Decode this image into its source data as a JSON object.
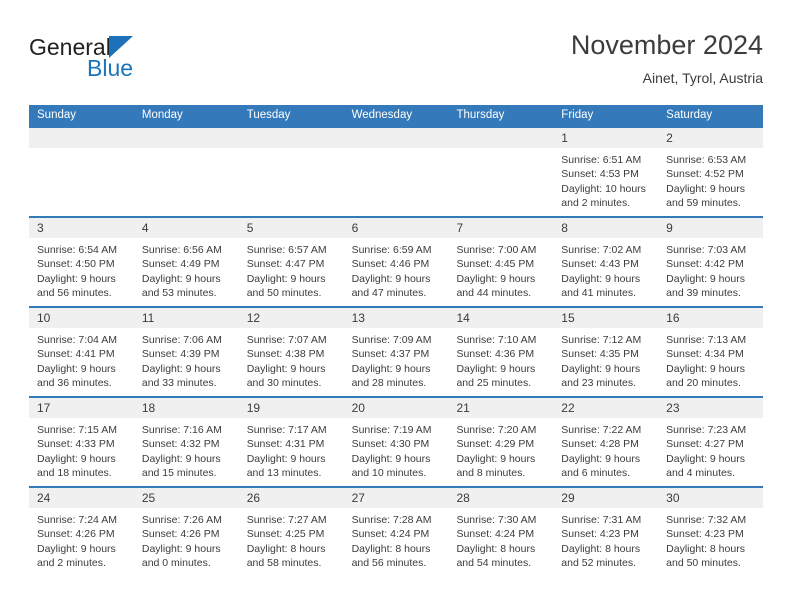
{
  "brand": {
    "name_part1": "General",
    "name_part2": "Blue",
    "triangle_color": "#1d71b8",
    "blue_color": "#1b75bb"
  },
  "header": {
    "title": "November 2024",
    "subtitle": "Ainet, Tyrol, Austria"
  },
  "theme": {
    "header_blue": "#3479ba",
    "daynum_band": "#f0f0f0",
    "text": "#3c3c3c"
  },
  "weekday_headers": [
    "Sunday",
    "Monday",
    "Tuesday",
    "Wednesday",
    "Thursday",
    "Friday",
    "Saturday"
  ],
  "weeks": [
    [
      {
        "day": "",
        "sunrise": "",
        "sunset": "",
        "daylight_line1": "",
        "daylight_line2": "",
        "empty": true
      },
      {
        "day": "",
        "sunrise": "",
        "sunset": "",
        "daylight_line1": "",
        "daylight_line2": "",
        "empty": true
      },
      {
        "day": "",
        "sunrise": "",
        "sunset": "",
        "daylight_line1": "",
        "daylight_line2": "",
        "empty": true
      },
      {
        "day": "",
        "sunrise": "",
        "sunset": "",
        "daylight_line1": "",
        "daylight_line2": "",
        "empty": true
      },
      {
        "day": "",
        "sunrise": "",
        "sunset": "",
        "daylight_line1": "",
        "daylight_line2": "",
        "empty": true
      },
      {
        "day": "1",
        "sunrise": "Sunrise: 6:51 AM",
        "sunset": "Sunset: 4:53 PM",
        "daylight_line1": "Daylight: 10 hours",
        "daylight_line2": "and 2 minutes."
      },
      {
        "day": "2",
        "sunrise": "Sunrise: 6:53 AM",
        "sunset": "Sunset: 4:52 PM",
        "daylight_line1": "Daylight: 9 hours",
        "daylight_line2": "and 59 minutes."
      }
    ],
    [
      {
        "day": "3",
        "sunrise": "Sunrise: 6:54 AM",
        "sunset": "Sunset: 4:50 PM",
        "daylight_line1": "Daylight: 9 hours",
        "daylight_line2": "and 56 minutes."
      },
      {
        "day": "4",
        "sunrise": "Sunrise: 6:56 AM",
        "sunset": "Sunset: 4:49 PM",
        "daylight_line1": "Daylight: 9 hours",
        "daylight_line2": "and 53 minutes."
      },
      {
        "day": "5",
        "sunrise": "Sunrise: 6:57 AM",
        "sunset": "Sunset: 4:47 PM",
        "daylight_line1": "Daylight: 9 hours",
        "daylight_line2": "and 50 minutes."
      },
      {
        "day": "6",
        "sunrise": "Sunrise: 6:59 AM",
        "sunset": "Sunset: 4:46 PM",
        "daylight_line1": "Daylight: 9 hours",
        "daylight_line2": "and 47 minutes."
      },
      {
        "day": "7",
        "sunrise": "Sunrise: 7:00 AM",
        "sunset": "Sunset: 4:45 PM",
        "daylight_line1": "Daylight: 9 hours",
        "daylight_line2": "and 44 minutes."
      },
      {
        "day": "8",
        "sunrise": "Sunrise: 7:02 AM",
        "sunset": "Sunset: 4:43 PM",
        "daylight_line1": "Daylight: 9 hours",
        "daylight_line2": "and 41 minutes."
      },
      {
        "day": "9",
        "sunrise": "Sunrise: 7:03 AM",
        "sunset": "Sunset: 4:42 PM",
        "daylight_line1": "Daylight: 9 hours",
        "daylight_line2": "and 39 minutes."
      }
    ],
    [
      {
        "day": "10",
        "sunrise": "Sunrise: 7:04 AM",
        "sunset": "Sunset: 4:41 PM",
        "daylight_line1": "Daylight: 9 hours",
        "daylight_line2": "and 36 minutes."
      },
      {
        "day": "11",
        "sunrise": "Sunrise: 7:06 AM",
        "sunset": "Sunset: 4:39 PM",
        "daylight_line1": "Daylight: 9 hours",
        "daylight_line2": "and 33 minutes."
      },
      {
        "day": "12",
        "sunrise": "Sunrise: 7:07 AM",
        "sunset": "Sunset: 4:38 PM",
        "daylight_line1": "Daylight: 9 hours",
        "daylight_line2": "and 30 minutes."
      },
      {
        "day": "13",
        "sunrise": "Sunrise: 7:09 AM",
        "sunset": "Sunset: 4:37 PM",
        "daylight_line1": "Daylight: 9 hours",
        "daylight_line2": "and 28 minutes."
      },
      {
        "day": "14",
        "sunrise": "Sunrise: 7:10 AM",
        "sunset": "Sunset: 4:36 PM",
        "daylight_line1": "Daylight: 9 hours",
        "daylight_line2": "and 25 minutes."
      },
      {
        "day": "15",
        "sunrise": "Sunrise: 7:12 AM",
        "sunset": "Sunset: 4:35 PM",
        "daylight_line1": "Daylight: 9 hours",
        "daylight_line2": "and 23 minutes."
      },
      {
        "day": "16",
        "sunrise": "Sunrise: 7:13 AM",
        "sunset": "Sunset: 4:34 PM",
        "daylight_line1": "Daylight: 9 hours",
        "daylight_line2": "and 20 minutes."
      }
    ],
    [
      {
        "day": "17",
        "sunrise": "Sunrise: 7:15 AM",
        "sunset": "Sunset: 4:33 PM",
        "daylight_line1": "Daylight: 9 hours",
        "daylight_line2": "and 18 minutes."
      },
      {
        "day": "18",
        "sunrise": "Sunrise: 7:16 AM",
        "sunset": "Sunset: 4:32 PM",
        "daylight_line1": "Daylight: 9 hours",
        "daylight_line2": "and 15 minutes."
      },
      {
        "day": "19",
        "sunrise": "Sunrise: 7:17 AM",
        "sunset": "Sunset: 4:31 PM",
        "daylight_line1": "Daylight: 9 hours",
        "daylight_line2": "and 13 minutes."
      },
      {
        "day": "20",
        "sunrise": "Sunrise: 7:19 AM",
        "sunset": "Sunset: 4:30 PM",
        "daylight_line1": "Daylight: 9 hours",
        "daylight_line2": "and 10 minutes."
      },
      {
        "day": "21",
        "sunrise": "Sunrise: 7:20 AM",
        "sunset": "Sunset: 4:29 PM",
        "daylight_line1": "Daylight: 9 hours",
        "daylight_line2": "and 8 minutes."
      },
      {
        "day": "22",
        "sunrise": "Sunrise: 7:22 AM",
        "sunset": "Sunset: 4:28 PM",
        "daylight_line1": "Daylight: 9 hours",
        "daylight_line2": "and 6 minutes."
      },
      {
        "day": "23",
        "sunrise": "Sunrise: 7:23 AM",
        "sunset": "Sunset: 4:27 PM",
        "daylight_line1": "Daylight: 9 hours",
        "daylight_line2": "and 4 minutes."
      }
    ],
    [
      {
        "day": "24",
        "sunrise": "Sunrise: 7:24 AM",
        "sunset": "Sunset: 4:26 PM",
        "daylight_line1": "Daylight: 9 hours",
        "daylight_line2": "and 2 minutes."
      },
      {
        "day": "25",
        "sunrise": "Sunrise: 7:26 AM",
        "sunset": "Sunset: 4:26 PM",
        "daylight_line1": "Daylight: 9 hours",
        "daylight_line2": "and 0 minutes."
      },
      {
        "day": "26",
        "sunrise": "Sunrise: 7:27 AM",
        "sunset": "Sunset: 4:25 PM",
        "daylight_line1": "Daylight: 8 hours",
        "daylight_line2": "and 58 minutes."
      },
      {
        "day": "27",
        "sunrise": "Sunrise: 7:28 AM",
        "sunset": "Sunset: 4:24 PM",
        "daylight_line1": "Daylight: 8 hours",
        "daylight_line2": "and 56 minutes."
      },
      {
        "day": "28",
        "sunrise": "Sunrise: 7:30 AM",
        "sunset": "Sunset: 4:24 PM",
        "daylight_line1": "Daylight: 8 hours",
        "daylight_line2": "and 54 minutes."
      },
      {
        "day": "29",
        "sunrise": "Sunrise: 7:31 AM",
        "sunset": "Sunset: 4:23 PM",
        "daylight_line1": "Daylight: 8 hours",
        "daylight_line2": "and 52 minutes."
      },
      {
        "day": "30",
        "sunrise": "Sunrise: 7:32 AM",
        "sunset": "Sunset: 4:23 PM",
        "daylight_line1": "Daylight: 8 hours",
        "daylight_line2": "and 50 minutes."
      }
    ]
  ]
}
